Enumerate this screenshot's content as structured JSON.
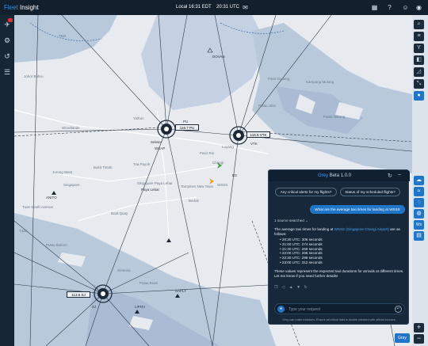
{
  "app": {
    "brand_primary": "Fleet",
    "brand_secondary": "Insight"
  },
  "header": {
    "local_time": "Local 16:31 EDT",
    "utc_time": "20:31 UTC",
    "icons": [
      "mail-icon",
      "grid-icon",
      "help-icon",
      "user-icon",
      "globe-icon"
    ]
  },
  "leftbar": {
    "alert_badge": ""
  },
  "map": {
    "labels": [
      "TMA",
      "Johor Bahru",
      "Pasir Gudang",
      "Tuas South Avenue",
      "Woodlands",
      "Yishun",
      "Singapore Paya Lebar",
      "Changi",
      "WSSS",
      "Jurong West",
      "Bukit Timah",
      "Toa Payoh",
      "Tampines New Town",
      "Pulau Ubin",
      "Pulau Tekong",
      "Kampung Mulong",
      "Loyang",
      "Pasir Ris",
      "Bedok",
      "Pulau Bukom",
      "Tuas",
      "Sentosa",
      "Boat Quay",
      "Pulau Brani",
      "Singapore"
    ],
    "vor_labels": [
      "Seletar",
      "Paya Lebar",
      "WSAP",
      "VTK",
      "PU",
      "SJ",
      "BS",
      "DOVAN",
      "ANITO",
      "SAPLY",
      "LIPOV"
    ],
    "frequency": "116.5 VTK",
    "frequency2": "113.5 SJ",
    "freq_box3": "116.7 PU"
  },
  "right_toolbar": {
    "tools": [
      "search-icon",
      "filter-icon",
      "route-icon",
      "layers-icon",
      "chart-icon",
      "cursor-icon",
      "chat-icon"
    ],
    "weather_tools": [
      "cloud-icon",
      "wind-icon",
      "radar-icon",
      "globe-icon",
      "temp-icon",
      "airmet-icon"
    ],
    "weather_labels": [
      "",
      "",
      "",
      "",
      "Wx",
      ""
    ]
  },
  "chat": {
    "brand": "Grey",
    "version": "Beta 1.0.0",
    "suggestions": [
      "Any critical alerts for my flights?",
      "Status of my scheduled flights?"
    ],
    "user_message": "What are the average taxi times for landing at WSSS",
    "sources": "1 source searched",
    "intro_before": "The average taxi times for landing at ",
    "intro_link": "WSSS (Singapore Changi Airport)",
    "intro_after": " are as follows:",
    "times": [
      "20:30 UTC: 306 seconds",
      "21:00 UTC: 274 seconds",
      "21:30 UTC: 269 seconds",
      "22:00 UTC: 266 seconds",
      "22:30 UTC: 298 seconds",
      "23:00 UTC: 312 seconds"
    ],
    "summary": "These values represent the expected taxi durations for arrivals at different times. Let me know if you need further details!",
    "input_placeholder": "Type your request",
    "disclaimer": "Grey can make mistakes. Ensure all critical data is double checked with official sources."
  },
  "zoom": {
    "plus": "+",
    "minus": "−"
  },
  "ask_button": "Grey",
  "colors": {
    "topbar": "#12202e",
    "accent": "#1f76c9",
    "water": "#b9c9dc",
    "land": "#e7ebf0",
    "panel": "#17283a"
  }
}
